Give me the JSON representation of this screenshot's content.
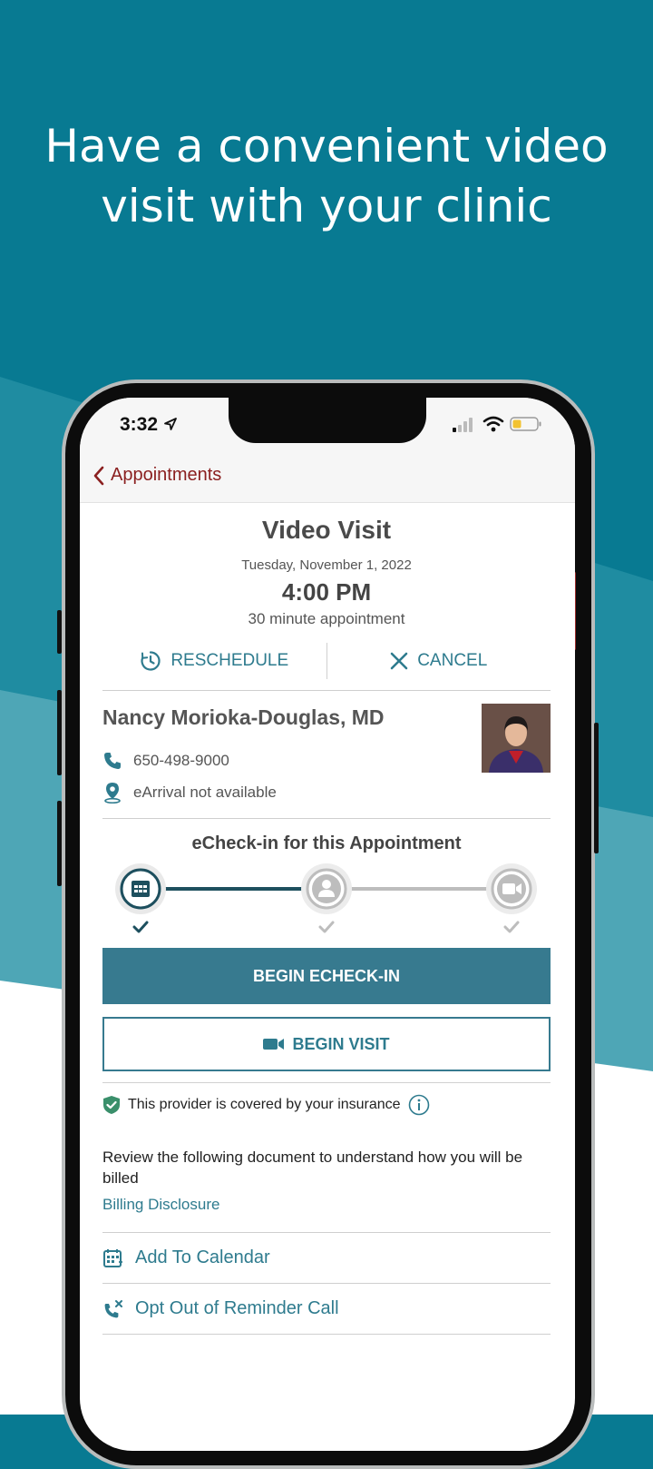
{
  "headline": {
    "line1": "Have a convenient video",
    "line2": "visit with your clinic"
  },
  "status_bar": {
    "time": "3:32"
  },
  "nav": {
    "back_label": "Appointments"
  },
  "visit": {
    "title": "Video Visit",
    "date": "Tuesday, November 1, 2022",
    "time": "4:00 PM",
    "duration": "30 minute appointment"
  },
  "actions": {
    "reschedule": "RESCHEDULE",
    "cancel": "CANCEL"
  },
  "provider": {
    "name": "Nancy Morioka-Douglas, MD",
    "phone": "650-498-9000",
    "earrival": "eArrival not available"
  },
  "echeckin": {
    "title": "eCheck-in for this Appointment",
    "steps": [
      "calendar-icon",
      "person-icon",
      "video-icon"
    ],
    "completed_steps": 1
  },
  "buttons": {
    "begin_echeckin": "BEGIN ECHECK-IN",
    "begin_visit": "BEGIN VISIT"
  },
  "insurance": {
    "text": "This provider is covered by your insurance"
  },
  "billing": {
    "text": "Review the following document to understand how you will be billed",
    "link": "Billing Disclosure"
  },
  "list": {
    "add_calendar": "Add To Calendar",
    "opt_out": "Opt Out of Reminder Call"
  },
  "colors": {
    "background_teal": "#087a92",
    "accent": "#2e7b8e",
    "back_red": "#8b2020",
    "button_fill": "#377a8f"
  }
}
